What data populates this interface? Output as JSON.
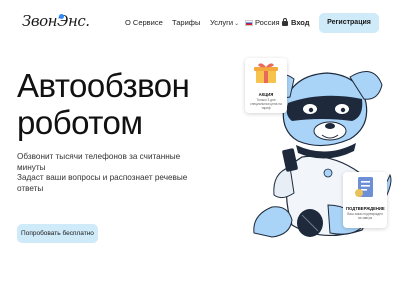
{
  "header": {
    "logo_text": "ЗвонЭнс.",
    "nav": {
      "services": "О Сервисе",
      "tariffs": "Тарифы",
      "services_menu": "Услуги",
      "region": "Россия",
      "login": "Вход"
    },
    "register_label": "Регистрация"
  },
  "hero": {
    "title_line1": "Автообзвон",
    "title_line2": "роботом",
    "paragraph1": "Обзвонит тысячи телефонов за считанные минуты",
    "paragraph2": "Задаст ваши вопросы и распознает речевые ответы",
    "cta_label": "Попробовать бесплатно"
  },
  "cards": {
    "promo_title": "АКЦИЯ",
    "promo_sub": "Только 3 дня специальная цена на тариф",
    "confirm_title": "ПОДТВЕРЖДЕНИЕ",
    "confirm_sub": "Ваш заказ подтвержден на завтра"
  },
  "colors": {
    "accent_button": "#cfeaf9",
    "robot_blue": "#a9d3f7",
    "robot_dark": "#1e2a3c",
    "flag_blue": "#1c48d6",
    "flag_red": "#e02020"
  }
}
